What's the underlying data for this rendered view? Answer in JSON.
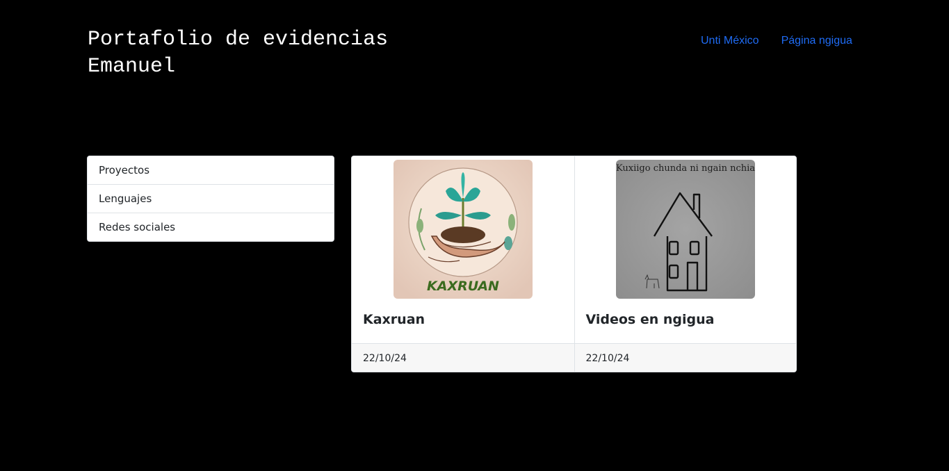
{
  "header": {
    "title_line1": "Portafolio de evidencias",
    "title_line2": "Emanuel"
  },
  "nav": {
    "links": [
      "Unti México",
      "Página ngigua"
    ],
    "link_color": "#1f6cf5"
  },
  "sidebar": {
    "items": [
      {
        "label": "Proyectos"
      },
      {
        "label": "Lenguajes"
      },
      {
        "label": "Redes sociales"
      }
    ]
  },
  "cards": [
    {
      "title": "Kaxruan",
      "date": "22/10/24",
      "image": {
        "type": "plant-in-hands-logo",
        "caption": "KAXRUAN"
      }
    },
    {
      "title": "Videos en ngigua",
      "date": "22/10/24",
      "image": {
        "type": "house-drawing",
        "caption": "Kuxiigo chunda ni ngain nchia"
      }
    }
  ],
  "colors": {
    "background": "#000000",
    "card_background": "#ffffff",
    "footer_background": "#f7f7f7"
  }
}
